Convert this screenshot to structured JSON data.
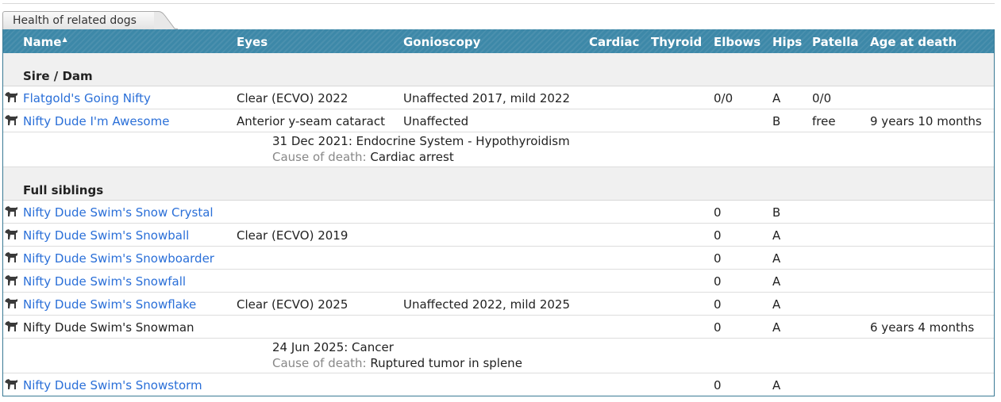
{
  "tab": {
    "title": "Health of related dogs"
  },
  "columns": [
    {
      "key": "name",
      "label": "Name"
    },
    {
      "key": "eyes",
      "label": "Eyes"
    },
    {
      "key": "gonioscopy",
      "label": "Gonioscopy"
    },
    {
      "key": "cardiac",
      "label": "Cardiac"
    },
    {
      "key": "thyroid",
      "label": "Thyroid"
    },
    {
      "key": "elbows",
      "label": "Elbows"
    },
    {
      "key": "hips",
      "label": "Hips"
    },
    {
      "key": "patella",
      "label": "Patella"
    },
    {
      "key": "age_at_death",
      "label": "Age at death"
    }
  ],
  "sort_indicator": "▲",
  "sections": [
    {
      "label": "Sire / Dam",
      "dogs": [
        {
          "name": "Flatgold's Going Nifty",
          "link": true,
          "eyes": "Clear (ECVO) 2022",
          "gonioscopy": "Unaffected 2017, mild 2022",
          "elbows": "0/0",
          "hips": "A",
          "patella": "0/0",
          "age_at_death": ""
        },
        {
          "name": "Nifty Dude I'm Awesome",
          "link": true,
          "eyes": "Anterior y-seam cataract",
          "gonioscopy": "Unaffected",
          "elbows": "",
          "hips": "B",
          "patella": "free",
          "age_at_death": "9 years 10 months",
          "detail": {
            "event": "31 Dec 2021: Endocrine System - Hypothyroidism",
            "cause_label": "Cause of death:",
            "cause": "Cardiac arrest"
          }
        }
      ]
    },
    {
      "label": "Full siblings",
      "dogs": [
        {
          "name": "Nifty Dude Swim's Snow Crystal",
          "link": true,
          "eyes": "",
          "gonioscopy": "",
          "elbows": "0",
          "hips": "B",
          "patella": "",
          "age_at_death": ""
        },
        {
          "name": "Nifty Dude Swim's Snowball",
          "link": true,
          "eyes": "Clear (ECVO) 2019",
          "gonioscopy": "",
          "elbows": "0",
          "hips": "A",
          "patella": "",
          "age_at_death": ""
        },
        {
          "name": "Nifty Dude Swim's Snowboarder",
          "link": true,
          "eyes": "",
          "gonioscopy": "",
          "elbows": "0",
          "hips": "A",
          "patella": "",
          "age_at_death": ""
        },
        {
          "name": "Nifty Dude Swim's Snowfall",
          "link": true,
          "eyes": "",
          "gonioscopy": "",
          "elbows": "0",
          "hips": "A",
          "patella": "",
          "age_at_death": ""
        },
        {
          "name": "Nifty Dude Swim's Snowflake",
          "link": true,
          "eyes": "Clear (ECVO) 2025",
          "gonioscopy": "Unaffected 2022, mild 2025",
          "elbows": "0",
          "hips": "A",
          "patella": "",
          "age_at_death": ""
        },
        {
          "name": "Nifty Dude Swim's Snowman",
          "link": false,
          "eyes": "",
          "gonioscopy": "",
          "elbows": "0",
          "hips": "A",
          "patella": "",
          "age_at_death": "6 years 4 months",
          "detail": {
            "event": "24 Jun 2025: Cancer",
            "cause_label": "Cause of death:",
            "cause": "Ruptured tumor in splene"
          }
        },
        {
          "name": "Nifty Dude Swim's Snowstorm",
          "link": true,
          "eyes": "",
          "gonioscopy": "",
          "elbows": "0",
          "hips": "A",
          "patella": "",
          "age_at_death": ""
        }
      ]
    }
  ],
  "colors": {
    "header": "#3d88a8",
    "link": "#2a6fd8",
    "section_bg": "#f0f0f0",
    "muted": "#888888"
  },
  "icons": {
    "row": "dog-silhouette-icon",
    "tab": "tab-icon"
  }
}
